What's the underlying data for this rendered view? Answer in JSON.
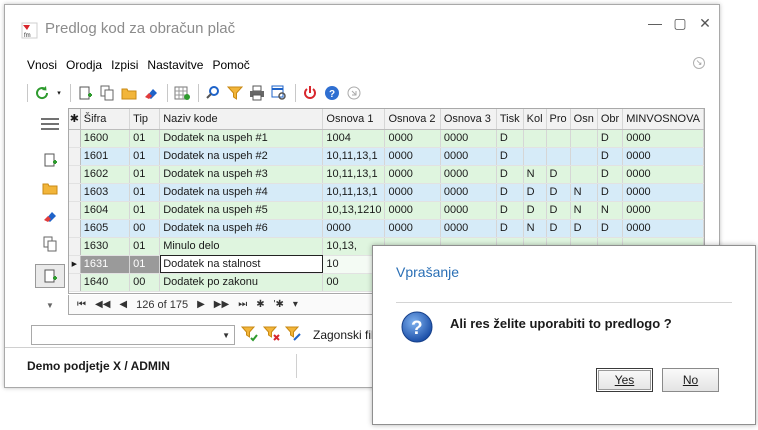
{
  "window": {
    "title": "Predlog kod za obračun plač"
  },
  "menu": [
    "Vnosi",
    "Orodja",
    "Izpisi",
    "Nastavitve",
    "Pomoč"
  ],
  "grid": {
    "headers": [
      "Šifra",
      "Tip",
      "Naziv kode",
      "Osnova 1",
      "Osnova 2",
      "Osnova 3",
      "Tisk",
      "Kol",
      "Pro",
      "Osn",
      "Obr",
      "MINVOSNOVA"
    ],
    "rows": [
      [
        "1600",
        "01",
        "Dodatek na uspeh #1",
        "1004",
        "0000",
        "0000",
        "D",
        "",
        "",
        "",
        "D",
        "0000"
      ],
      [
        "1601",
        "01",
        "Dodatek na uspeh #2",
        "10,11,13,1",
        "0000",
        "0000",
        "D",
        "",
        "",
        "",
        "D",
        "0000"
      ],
      [
        "1602",
        "01",
        "Dodatek na uspeh #3",
        "10,11,13,1",
        "0000",
        "0000",
        "D",
        "N",
        "D",
        "",
        "D",
        "0000"
      ],
      [
        "1603",
        "01",
        "Dodatek na uspeh #4",
        "10,11,13,1",
        "0000",
        "0000",
        "D",
        "D",
        "D",
        "N",
        "D",
        "0000"
      ],
      [
        "1604",
        "01",
        "Dodatek na uspeh #5",
        "10,13,1210",
        "0000",
        "0000",
        "D",
        "D",
        "D",
        "N",
        "N",
        "0000"
      ],
      [
        "1605",
        "00",
        "Dodatek na uspeh #6",
        "0000",
        "0000",
        "0000",
        "D",
        "N",
        "D",
        "D",
        "D",
        "0000"
      ],
      [
        "1630",
        "01",
        "Minulo delo",
        "10,13,",
        "",
        "",
        "",
        "",
        "",
        "",
        "",
        ""
      ],
      [
        "1631",
        "01",
        "Dodatek na stalnost",
        "10",
        "",
        "",
        "",
        "",
        "",
        "",
        "",
        ""
      ],
      [
        "1640",
        "00",
        "Dodatek po zakonu",
        "00",
        "",
        "",
        "",
        "",
        "",
        "",
        "",
        ""
      ]
    ],
    "selected_row": 7
  },
  "navigator": {
    "position": "126 of 175"
  },
  "filter": {
    "label": "Zagonski filte"
  },
  "status": {
    "text": "Demo podjetje X / ADMIN"
  },
  "dialog": {
    "title": "Vprašanje",
    "message": "Ali res želite uporabiti to predlogo ?",
    "yes": "Yes",
    "no": "No"
  }
}
